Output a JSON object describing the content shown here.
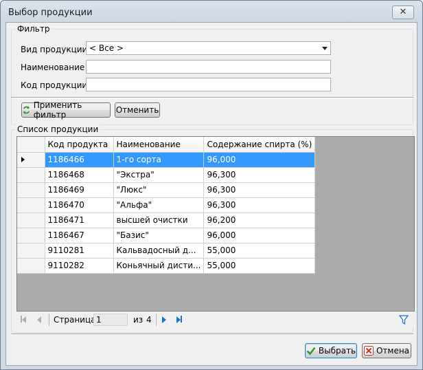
{
  "window": {
    "title": "Выбор продукции",
    "close_glyph": "✕"
  },
  "filter": {
    "legend": "Фильтр",
    "product_type_label": "Вид продукции",
    "product_type_value": "< Все >",
    "name_label": "Наименование",
    "name_value": "",
    "code_label": "Код продукции",
    "code_value": "",
    "apply_label": "Применить фильтр",
    "cancel_label": "Отменить"
  },
  "list": {
    "legend": "Список продукции",
    "columns": [
      "Код продукта",
      "Наименование",
      "Содержание спирта (%)"
    ],
    "rows": [
      [
        "1186466",
        "1-го сорта",
        "96,000"
      ],
      [
        "1186468",
        "\"Экстра\"",
        "96,300"
      ],
      [
        "1186469",
        "\"Люкс\"",
        "96,300"
      ],
      [
        "1186470",
        "\"Альфа\"",
        "96,300"
      ],
      [
        "1186471",
        "высшей очистки",
        "96,200"
      ],
      [
        "1186467",
        "\"Базис\"",
        "96,000"
      ],
      [
        "9110281",
        "Кальвадосный д...",
        "55,000"
      ],
      [
        "9110282",
        "Коньячный дисти...",
        "55,000"
      ]
    ],
    "selected_row": 0
  },
  "pager": {
    "page_label": "Страница",
    "page_value": "1",
    "of_label": "из",
    "total_pages": "4"
  },
  "footer": {
    "ok_label": "Выбрать",
    "cancel_label": "Отмена"
  },
  "colors": {
    "selection": "#3399ff",
    "grid_background": "#ababab",
    "nav_blue": "#1a6fd8"
  }
}
